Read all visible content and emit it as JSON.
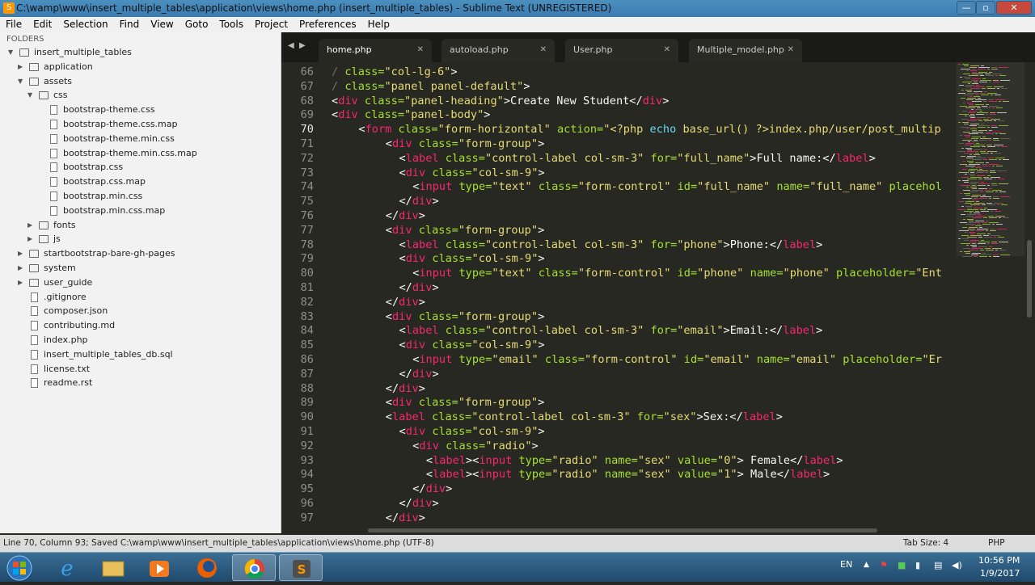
{
  "window": {
    "title": "C:\\wamp\\www\\insert_multiple_tables\\application\\views\\home.php (insert_multiple_tables) - Sublime Text (UNREGISTERED)",
    "min": "—",
    "max": "▫",
    "close": "✕"
  },
  "menu": [
    "File",
    "Edit",
    "Selection",
    "Find",
    "View",
    "Goto",
    "Tools",
    "Project",
    "Preferences",
    "Help"
  ],
  "sidebar": {
    "header": "FOLDERS",
    "items": [
      {
        "label": "insert_multiple_tables",
        "type": "folder",
        "open": true,
        "depth": 0
      },
      {
        "label": "application",
        "type": "folder",
        "open": false,
        "depth": 1
      },
      {
        "label": "assets",
        "type": "folder",
        "open": true,
        "depth": 1
      },
      {
        "label": "css",
        "type": "folder",
        "open": true,
        "depth": 2
      },
      {
        "label": "bootstrap-theme.css",
        "type": "file",
        "depth": 3
      },
      {
        "label": "bootstrap-theme.css.map",
        "type": "file",
        "depth": 3
      },
      {
        "label": "bootstrap-theme.min.css",
        "type": "file",
        "depth": 3
      },
      {
        "label": "bootstrap-theme.min.css.map",
        "type": "file",
        "depth": 3
      },
      {
        "label": "bootstrap.css",
        "type": "file",
        "depth": 3
      },
      {
        "label": "bootstrap.css.map",
        "type": "file",
        "depth": 3
      },
      {
        "label": "bootstrap.min.css",
        "type": "file",
        "depth": 3
      },
      {
        "label": "bootstrap.min.css.map",
        "type": "file",
        "depth": 3
      },
      {
        "label": "fonts",
        "type": "folder",
        "open": false,
        "depth": 2
      },
      {
        "label": "js",
        "type": "folder",
        "open": false,
        "depth": 2
      },
      {
        "label": "startbootstrap-bare-gh-pages",
        "type": "folder",
        "open": false,
        "depth": 1
      },
      {
        "label": "system",
        "type": "folder",
        "open": false,
        "depth": 1
      },
      {
        "label": "user_guide",
        "type": "folder",
        "open": false,
        "depth": 1
      },
      {
        "label": ".gitignore",
        "type": "file",
        "depth": 1
      },
      {
        "label": "composer.json",
        "type": "file",
        "depth": 1
      },
      {
        "label": "contributing.md",
        "type": "file",
        "depth": 1
      },
      {
        "label": "index.php",
        "type": "file",
        "depth": 1
      },
      {
        "label": "insert_multiple_tables_db.sql",
        "type": "file",
        "depth": 1
      },
      {
        "label": "license.txt",
        "type": "file",
        "depth": 1
      },
      {
        "label": "readme.rst",
        "type": "file",
        "depth": 1
      }
    ]
  },
  "tabs": [
    {
      "label": "home.php",
      "active": true
    },
    {
      "label": "autoload.php",
      "active": false
    },
    {
      "label": "User.php",
      "active": false
    },
    {
      "label": "Multiple_model.php",
      "active": false
    }
  ],
  "editor": {
    "current_line": 70,
    "lines": [
      {
        "n": 66,
        "i": 0,
        "t": [
          [
            "/ ",
            "#75715e"
          ],
          [
            "class=",
            "#a6e22e"
          ],
          [
            "\"col-lg-6\"",
            "#e6db74"
          ],
          [
            ">",
            "#f8f8f2"
          ]
        ]
      },
      {
        "n": 67,
        "i": 0,
        "t": [
          [
            "/ ",
            "#75715e"
          ],
          [
            "class=",
            "#a6e22e"
          ],
          [
            "\"panel panel-default\"",
            "#e6db74"
          ],
          [
            ">",
            "#f8f8f2"
          ]
        ]
      },
      {
        "n": 68,
        "i": 0,
        "t": [
          [
            "<",
            "#f8f8f2"
          ],
          [
            "div",
            "#f92672"
          ],
          [
            " class=",
            "#a6e22e"
          ],
          [
            "\"panel-heading\"",
            "#e6db74"
          ],
          [
            ">Create New Student</",
            "#f8f8f2"
          ],
          [
            "div",
            "#f92672"
          ],
          [
            ">",
            "#f8f8f2"
          ]
        ]
      },
      {
        "n": 69,
        "i": 0,
        "t": [
          [
            "<",
            "#f8f8f2"
          ],
          [
            "div",
            "#f92672"
          ],
          [
            " class=",
            "#a6e22e"
          ],
          [
            "\"panel-body\"",
            "#e6db74"
          ],
          [
            ">",
            "#f8f8f2"
          ]
        ]
      },
      {
        "n": 70,
        "i": 4,
        "t": [
          [
            "<",
            "#f8f8f2"
          ],
          [
            "form",
            "#f92672"
          ],
          [
            " class=",
            "#a6e22e"
          ],
          [
            "\"form-horizontal\"",
            "#e6db74"
          ],
          [
            " action=",
            "#a6e22e"
          ],
          [
            "\"<?php ",
            "#e6db74"
          ],
          [
            "echo",
            "#66d9ef"
          ],
          [
            " base_url() ?>index.php/user/post_multip",
            "#e6db74"
          ]
        ]
      },
      {
        "n": 71,
        "i": 8,
        "t": [
          [
            "<",
            "#f8f8f2"
          ],
          [
            "div",
            "#f92672"
          ],
          [
            " class=",
            "#a6e22e"
          ],
          [
            "\"form-group\"",
            "#e6db74"
          ],
          [
            ">",
            "#f8f8f2"
          ]
        ]
      },
      {
        "n": 72,
        "i": 10,
        "t": [
          [
            "<",
            "#f8f8f2"
          ],
          [
            "label",
            "#f92672"
          ],
          [
            " class=",
            "#a6e22e"
          ],
          [
            "\"control-label col-sm-3\"",
            "#e6db74"
          ],
          [
            " for=",
            "#a6e22e"
          ],
          [
            "\"full_name\"",
            "#e6db74"
          ],
          [
            ">Full name:</",
            "#f8f8f2"
          ],
          [
            "label",
            "#f92672"
          ],
          [
            ">",
            "#f8f8f2"
          ]
        ]
      },
      {
        "n": 73,
        "i": 10,
        "t": [
          [
            "<",
            "#f8f8f2"
          ],
          [
            "div",
            "#f92672"
          ],
          [
            " class=",
            "#a6e22e"
          ],
          [
            "\"col-sm-9\"",
            "#e6db74"
          ],
          [
            ">",
            "#f8f8f2"
          ]
        ]
      },
      {
        "n": 74,
        "i": 12,
        "t": [
          [
            "<",
            "#f8f8f2"
          ],
          [
            "input",
            "#f92672"
          ],
          [
            " type=",
            "#a6e22e"
          ],
          [
            "\"text\"",
            "#e6db74"
          ],
          [
            " class=",
            "#a6e22e"
          ],
          [
            "\"form-control\"",
            "#e6db74"
          ],
          [
            " id=",
            "#a6e22e"
          ],
          [
            "\"full_name\"",
            "#e6db74"
          ],
          [
            " name=",
            "#a6e22e"
          ],
          [
            "\"full_name\"",
            "#e6db74"
          ],
          [
            " placehol",
            "#a6e22e"
          ]
        ]
      },
      {
        "n": 75,
        "i": 10,
        "t": [
          [
            "</",
            "#f8f8f2"
          ],
          [
            "div",
            "#f92672"
          ],
          [
            ">",
            "#f8f8f2"
          ]
        ]
      },
      {
        "n": 76,
        "i": 8,
        "t": [
          [
            "</",
            "#f8f8f2"
          ],
          [
            "div",
            "#f92672"
          ],
          [
            ">",
            "#f8f8f2"
          ]
        ]
      },
      {
        "n": 77,
        "i": 8,
        "t": [
          [
            "<",
            "#f8f8f2"
          ],
          [
            "div",
            "#f92672"
          ],
          [
            " class=",
            "#a6e22e"
          ],
          [
            "\"form-group\"",
            "#e6db74"
          ],
          [
            ">",
            "#f8f8f2"
          ]
        ]
      },
      {
        "n": 78,
        "i": 10,
        "t": [
          [
            "<",
            "#f8f8f2"
          ],
          [
            "label",
            "#f92672"
          ],
          [
            " class=",
            "#a6e22e"
          ],
          [
            "\"control-label col-sm-3\"",
            "#e6db74"
          ],
          [
            " for=",
            "#a6e22e"
          ],
          [
            "\"phone\"",
            "#e6db74"
          ],
          [
            ">Phone:</",
            "#f8f8f2"
          ],
          [
            "label",
            "#f92672"
          ],
          [
            ">",
            "#f8f8f2"
          ]
        ]
      },
      {
        "n": 79,
        "i": 10,
        "t": [
          [
            "<",
            "#f8f8f2"
          ],
          [
            "div",
            "#f92672"
          ],
          [
            " class=",
            "#a6e22e"
          ],
          [
            "\"col-sm-9\"",
            "#e6db74"
          ],
          [
            ">",
            "#f8f8f2"
          ]
        ]
      },
      {
        "n": 80,
        "i": 12,
        "t": [
          [
            "<",
            "#f8f8f2"
          ],
          [
            "input",
            "#f92672"
          ],
          [
            " type=",
            "#a6e22e"
          ],
          [
            "\"text\"",
            "#e6db74"
          ],
          [
            " class=",
            "#a6e22e"
          ],
          [
            "\"form-control\"",
            "#e6db74"
          ],
          [
            " id=",
            "#a6e22e"
          ],
          [
            "\"phone\"",
            "#e6db74"
          ],
          [
            " name=",
            "#a6e22e"
          ],
          [
            "\"phone\"",
            "#e6db74"
          ],
          [
            " placeholder=",
            "#a6e22e"
          ],
          [
            "\"Ent",
            "#e6db74"
          ]
        ]
      },
      {
        "n": 81,
        "i": 10,
        "t": [
          [
            "</",
            "#f8f8f2"
          ],
          [
            "div",
            "#f92672"
          ],
          [
            ">",
            "#f8f8f2"
          ]
        ]
      },
      {
        "n": 82,
        "i": 8,
        "t": [
          [
            "</",
            "#f8f8f2"
          ],
          [
            "div",
            "#f92672"
          ],
          [
            ">",
            "#f8f8f2"
          ]
        ]
      },
      {
        "n": 83,
        "i": 8,
        "t": [
          [
            "<",
            "#f8f8f2"
          ],
          [
            "div",
            "#f92672"
          ],
          [
            " class=",
            "#a6e22e"
          ],
          [
            "\"form-group\"",
            "#e6db74"
          ],
          [
            ">",
            "#f8f8f2"
          ]
        ]
      },
      {
        "n": 84,
        "i": 10,
        "t": [
          [
            "<",
            "#f8f8f2"
          ],
          [
            "label",
            "#f92672"
          ],
          [
            " class=",
            "#a6e22e"
          ],
          [
            "\"control-label col-sm-3\"",
            "#e6db74"
          ],
          [
            " for=",
            "#a6e22e"
          ],
          [
            "\"email\"",
            "#e6db74"
          ],
          [
            ">Email:</",
            "#f8f8f2"
          ],
          [
            "label",
            "#f92672"
          ],
          [
            ">",
            "#f8f8f2"
          ]
        ]
      },
      {
        "n": 85,
        "i": 10,
        "t": [
          [
            "<",
            "#f8f8f2"
          ],
          [
            "div",
            "#f92672"
          ],
          [
            " class=",
            "#a6e22e"
          ],
          [
            "\"col-sm-9\"",
            "#e6db74"
          ],
          [
            ">",
            "#f8f8f2"
          ]
        ]
      },
      {
        "n": 86,
        "i": 12,
        "t": [
          [
            "<",
            "#f8f8f2"
          ],
          [
            "input",
            "#f92672"
          ],
          [
            " type=",
            "#a6e22e"
          ],
          [
            "\"email\"",
            "#e6db74"
          ],
          [
            " class=",
            "#a6e22e"
          ],
          [
            "\"form-control\"",
            "#e6db74"
          ],
          [
            " id=",
            "#a6e22e"
          ],
          [
            "\"email\"",
            "#e6db74"
          ],
          [
            " name=",
            "#a6e22e"
          ],
          [
            "\"email\"",
            "#e6db74"
          ],
          [
            " placeholder=",
            "#a6e22e"
          ],
          [
            "\"Er",
            "#e6db74"
          ]
        ]
      },
      {
        "n": 87,
        "i": 10,
        "t": [
          [
            "</",
            "#f8f8f2"
          ],
          [
            "div",
            "#f92672"
          ],
          [
            ">",
            "#f8f8f2"
          ]
        ]
      },
      {
        "n": 88,
        "i": 8,
        "t": [
          [
            "</",
            "#f8f8f2"
          ],
          [
            "div",
            "#f92672"
          ],
          [
            ">",
            "#f8f8f2"
          ]
        ]
      },
      {
        "n": 89,
        "i": 8,
        "t": [
          [
            "<",
            "#f8f8f2"
          ],
          [
            "div",
            "#f92672"
          ],
          [
            " class=",
            "#a6e22e"
          ],
          [
            "\"form-group\"",
            "#e6db74"
          ],
          [
            ">",
            "#f8f8f2"
          ]
        ]
      },
      {
        "n": 90,
        "i": 8,
        "t": [
          [
            "<",
            "#f8f8f2"
          ],
          [
            "label",
            "#f92672"
          ],
          [
            " class=",
            "#a6e22e"
          ],
          [
            "\"control-label col-sm-3\"",
            "#e6db74"
          ],
          [
            " for=",
            "#a6e22e"
          ],
          [
            "\"sex\"",
            "#e6db74"
          ],
          [
            ">Sex:</",
            "#f8f8f2"
          ],
          [
            "label",
            "#f92672"
          ],
          [
            ">",
            "#f8f8f2"
          ]
        ]
      },
      {
        "n": 91,
        "i": 10,
        "t": [
          [
            "<",
            "#f8f8f2"
          ],
          [
            "div",
            "#f92672"
          ],
          [
            " class=",
            "#a6e22e"
          ],
          [
            "\"col-sm-9\"",
            "#e6db74"
          ],
          [
            ">",
            "#f8f8f2"
          ]
        ]
      },
      {
        "n": 92,
        "i": 12,
        "t": [
          [
            "<",
            "#f8f8f2"
          ],
          [
            "div",
            "#f92672"
          ],
          [
            " class=",
            "#a6e22e"
          ],
          [
            "\"radio\"",
            "#e6db74"
          ],
          [
            ">",
            "#f8f8f2"
          ]
        ]
      },
      {
        "n": 93,
        "i": 14,
        "t": [
          [
            "<",
            "#f8f8f2"
          ],
          [
            "label",
            "#f92672"
          ],
          [
            "><",
            "#f8f8f2"
          ],
          [
            "input",
            "#f92672"
          ],
          [
            " type=",
            "#a6e22e"
          ],
          [
            "\"radio\"",
            "#e6db74"
          ],
          [
            " name=",
            "#a6e22e"
          ],
          [
            "\"sex\"",
            "#e6db74"
          ],
          [
            " value=",
            "#a6e22e"
          ],
          [
            "\"0\"",
            "#e6db74"
          ],
          [
            "> Female</",
            "#f8f8f2"
          ],
          [
            "label",
            "#f92672"
          ],
          [
            ">",
            "#f8f8f2"
          ]
        ]
      },
      {
        "n": 94,
        "i": 14,
        "t": [
          [
            "<",
            "#f8f8f2"
          ],
          [
            "label",
            "#f92672"
          ],
          [
            "><",
            "#f8f8f2"
          ],
          [
            "input",
            "#f92672"
          ],
          [
            " type=",
            "#a6e22e"
          ],
          [
            "\"radio\"",
            "#e6db74"
          ],
          [
            " name=",
            "#a6e22e"
          ],
          [
            "\"sex\"",
            "#e6db74"
          ],
          [
            " value=",
            "#a6e22e"
          ],
          [
            "\"1\"",
            "#e6db74"
          ],
          [
            "> Male</",
            "#f8f8f2"
          ],
          [
            "label",
            "#f92672"
          ],
          [
            ">",
            "#f8f8f2"
          ]
        ]
      },
      {
        "n": 95,
        "i": 12,
        "t": [
          [
            "</",
            "#f8f8f2"
          ],
          [
            "div",
            "#f92672"
          ],
          [
            ">",
            "#f8f8f2"
          ]
        ]
      },
      {
        "n": 96,
        "i": 10,
        "t": [
          [
            "</",
            "#f8f8f2"
          ],
          [
            "div",
            "#f92672"
          ],
          [
            ">",
            "#f8f8f2"
          ]
        ]
      },
      {
        "n": 97,
        "i": 8,
        "t": [
          [
            "</",
            "#f8f8f2"
          ],
          [
            "div",
            "#f92672"
          ],
          [
            ">",
            "#f8f8f2"
          ]
        ]
      }
    ]
  },
  "status": {
    "left": "Line 70, Column 93; Saved C:\\wamp\\www\\insert_multiple_tables\\application\\views\\home.php (UTF-8)",
    "tabsize": "Tab Size: 4",
    "syntax": "PHP"
  },
  "taskbar": {
    "apps": [
      "start",
      "ie",
      "explorer",
      "media",
      "firefox",
      "chrome",
      "sublime"
    ],
    "active_app": "chrome",
    "lang": "EN",
    "time": "10:56 PM",
    "date": "1/9/2017"
  }
}
